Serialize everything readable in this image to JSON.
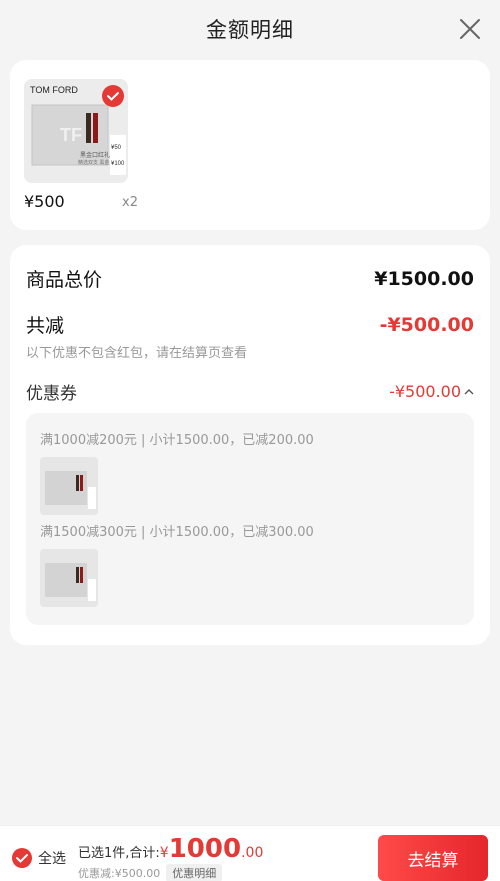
{
  "header": {
    "title": "金额明细"
  },
  "product": {
    "brand": "TOM FORD",
    "box_label": "TF",
    "box_caption": "黑金口红礼盒",
    "box_caption_2": "精选双支 黑金之礼",
    "tag_1": "¥50",
    "tag_2": "¥100",
    "price": "¥500",
    "qty": "x2"
  },
  "summary": {
    "total_label": "商品总价",
    "total_value": "¥1500.00",
    "discount_label": "共减",
    "discount_value": "-¥500.00",
    "note": "以下优惠不包含红包，请在结算页查看",
    "coupon_label": "优惠券",
    "coupon_value": "-¥500.00",
    "coupons": [
      {
        "desc": "满1000减200元 | 小计1500.00，已减200.00"
      },
      {
        "desc": "满1500减300元 | 小计1500.00，已减300.00"
      }
    ]
  },
  "footer": {
    "select_all": "全选",
    "selected_prefix": "已选1件,合计:",
    "currency": "¥",
    "total_int": "1000",
    "total_dec": ".00",
    "discount_text": "优惠减:¥500.00",
    "detail_label": "优惠明细",
    "checkout_label": "去结算"
  },
  "colors": {
    "accent": "#e53935",
    "background": "#f4f4f4"
  }
}
